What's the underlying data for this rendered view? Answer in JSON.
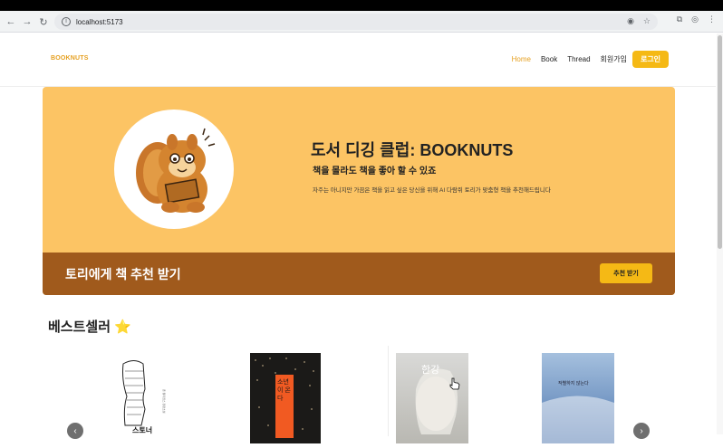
{
  "browser": {
    "url": "localhost:5173",
    "back_icon": "arrow-left-icon",
    "forward_icon": "arrow-right-icon",
    "reload_icon": "reload-icon"
  },
  "header": {
    "logo": "BOOKNUTS",
    "menu": [
      "Home",
      "Book",
      "Thread",
      "회원가입"
    ],
    "login_label": "로그인",
    "accent": "#f5b915"
  },
  "hero": {
    "title": "도서 디깅 클럽: BOOKNUTS",
    "subtitle": "책을 몰라도 책을 좋아 할 수 있죠",
    "description": "자주는 아니지만 가끔은 책을 읽고 싶은 당신을 위해 AI 다람쥐 토리가 맞춤형 책을 추천해드립니다",
    "bottom_title": "토리에게 책 추천 받기",
    "recommend_label": "추천 받기",
    "bg": "#fcc464",
    "bottom_bg": "#a05a1c"
  },
  "bestseller": {
    "title": "베스트셀러",
    "emoji": "⭐",
    "books": [
      {
        "cover_text": "스토너"
      },
      {
        "cover_text": "소년이 온다"
      },
      {
        "cover_text": "한강"
      },
      {
        "cover_text": "작별하지 않는다"
      }
    ]
  }
}
